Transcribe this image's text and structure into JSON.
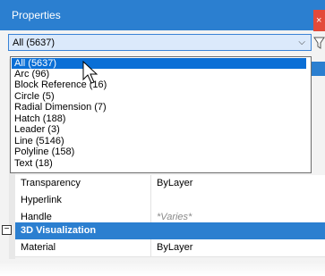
{
  "window": {
    "title": "Properties",
    "close_glyph": "×"
  },
  "selector": {
    "value": "All (5637)",
    "chevron": "⌵"
  },
  "dropdown": {
    "items": [
      "All (5637)",
      "Arc (96)",
      "Block Reference (16)",
      "Circle (5)",
      "Radial Dimension (7)",
      "Hatch (188)",
      "Leader (3)",
      "Line (5146)",
      "Polyline (158)",
      "Text (18)"
    ],
    "selected_index": 0
  },
  "properties": {
    "rows": [
      {
        "name": "Transparency",
        "value": "ByLayer"
      },
      {
        "name": "Hyperlink",
        "value": ""
      },
      {
        "name": "Handle",
        "value": "*Varies*"
      }
    ],
    "section": {
      "label": "3D Visualization",
      "collapse_glyph": "−"
    },
    "section_rows": [
      {
        "name": "Material",
        "value": "ByLayer"
      }
    ]
  },
  "colors": {
    "accent": "#2b7fd0",
    "selected": "#0a6fd6",
    "close": "#e34a3a"
  }
}
